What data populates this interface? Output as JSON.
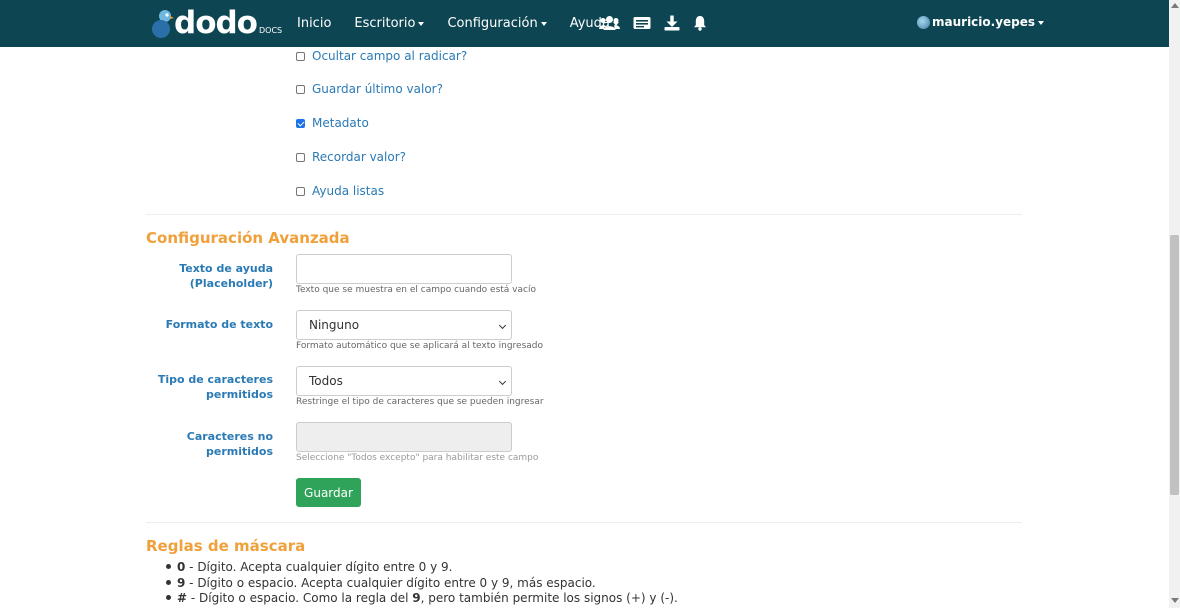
{
  "navbar": {
    "brand": "dodo",
    "brand_sub": "DOCS",
    "items": [
      {
        "label": "Inicio",
        "has_caret": false
      },
      {
        "label": "Escritorio",
        "has_caret": true
      },
      {
        "label": "Configuración",
        "has_caret": true
      },
      {
        "label": "Ayuda",
        "has_caret": true
      }
    ],
    "icons": [
      "users-icon",
      "id-card-icon",
      "download-icon",
      "bell-icon"
    ],
    "user": "mauricio.yepes",
    "background_color": "#0e4552"
  },
  "checkboxes": [
    {
      "label": "Ocultar campo al radicar?",
      "checked": false
    },
    {
      "label": "Guardar último valor?",
      "checked": false
    },
    {
      "label": "Metadato",
      "checked": true
    },
    {
      "label": "Recordar valor?",
      "checked": false
    },
    {
      "label": "Ayuda listas",
      "checked": false
    }
  ],
  "advanced": {
    "title": "Configuración Avanzada",
    "placeholder_label": "Texto de ayuda (Placeholder)",
    "placeholder_value": "",
    "placeholder_help": "Texto que se muestra en el campo cuando está vacío",
    "format_label": "Formato de texto",
    "format_value": "Ninguno",
    "format_help": "Formato automático que se aplicará al texto ingresado",
    "chartype_label": "Tipo de caracteres permitidos",
    "chartype_value": "Todos",
    "chartype_help": "Restringe el tipo de caracteres que se pueden ingresar",
    "notallowed_label": "Caracteres no permitidos",
    "notallowed_value": "",
    "notallowed_help": "Seleccione \"Todos excepto\" para habilitar este campo",
    "save_button": "Guardar"
  },
  "mask_rules": {
    "title": "Reglas de máscara",
    "rules": [
      {
        "code": "0",
        "text": " - Dígito. Acepta cualquier dígito entre 0 y 9."
      },
      {
        "code": "9",
        "text": " - Dígito o espacio. Acepta cualquier dígito entre 0 y 9, más espacio."
      },
      {
        "code": "#",
        "text_before": " - Dígito o espacio. Como la regla del ",
        "ref": "9",
        "text_after": ", pero también permite los signos (+) y (-)."
      }
    ]
  },
  "colors": {
    "accent_orange": "#f0a03a",
    "link_blue": "#2a7ab5",
    "button_green": "#2fa35a"
  }
}
